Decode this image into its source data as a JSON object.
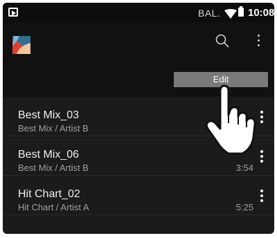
{
  "statusbar": {
    "carrier": "BAL.",
    "time": "10:08",
    "icons": [
      "notification-icon",
      "wifi-icon",
      "battery-icon"
    ]
  },
  "toolbar": {
    "icons": [
      "app-logo",
      "search-icon",
      "more-icon"
    ]
  },
  "menu": {
    "edit_label": "Edit"
  },
  "tracks": [
    {
      "title": "Best Mix_03",
      "subtitle": "Best Mix / Artist B",
      "duration": ""
    },
    {
      "title": "Best Mix_06",
      "subtitle": "Best Mix / Artist B",
      "duration": "3:54"
    },
    {
      "title": "Hit Chart_02",
      "subtitle": "Hit Chart / Artist A",
      "duration": "5:25"
    }
  ],
  "colors": {
    "background": "#1b1b1b",
    "menu_item": "#7a7a7a",
    "text_primary": "#f0f0f0",
    "text_secondary": "#a0a0a0"
  }
}
